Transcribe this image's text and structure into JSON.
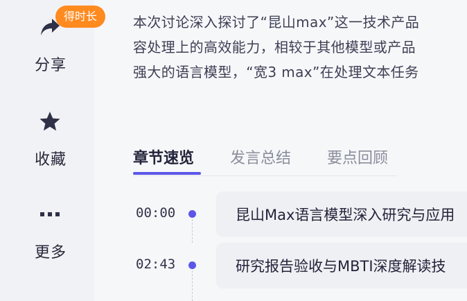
{
  "rail": {
    "share": {
      "label": "分享",
      "icon": "share-arrow-icon"
    },
    "badge": {
      "label": "得时长"
    },
    "favorite": {
      "label": "收藏",
      "icon": "star-icon"
    },
    "more": {
      "label": "更多",
      "icon": "ellipsis-icon"
    }
  },
  "summary": {
    "lines": [
      "本次讨论深入探讨了“昆山max”这一技术产品",
      "容处理上的高效能力，相较于其他模型或产品",
      "强大的语言模型，“宽3 max”在处理文本任务"
    ]
  },
  "tabs": [
    {
      "label": "章节速览",
      "active": true
    },
    {
      "label": "发言总结",
      "active": false
    },
    {
      "label": "要点回顾",
      "active": false
    }
  ],
  "chapters": [
    {
      "time": "00:00",
      "title": "昆山Max语言模型深入研究与应用"
    },
    {
      "time": "02:43",
      "title": "研究报告验收与MBTI深度解读技"
    }
  ],
  "colors": {
    "accent": "#5b57e8",
    "badge": "#ff8a1f",
    "text": "#27283a"
  }
}
